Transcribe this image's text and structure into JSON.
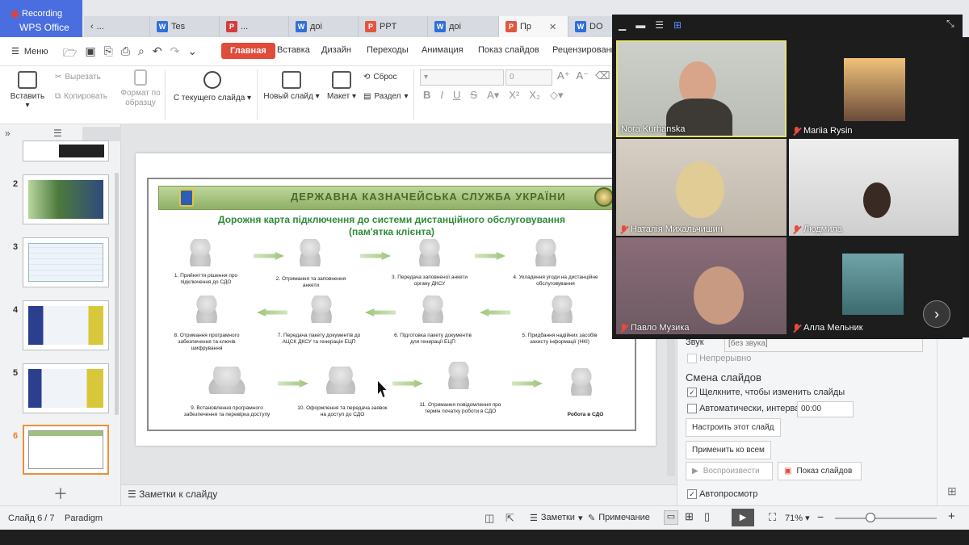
{
  "app": {
    "recording_label": "Recording",
    "home_label": "WPS Office"
  },
  "tabs": [
    {
      "label": "...",
      "icon": "back-arrow"
    },
    {
      "label": "Tes",
      "type": "writer"
    },
    {
      "label": "...",
      "type": "pdf"
    },
    {
      "label": "доі",
      "type": "writer"
    },
    {
      "label": "PPT",
      "type": "presentation"
    },
    {
      "label": "доі",
      "type": "writer"
    },
    {
      "label": "Пр",
      "type": "presentation",
      "active": true
    },
    {
      "label": "DO",
      "type": "writer"
    }
  ],
  "menu": {
    "menu_label": "Меню",
    "tabs": [
      "Главная",
      "Вставка",
      "Дизайн",
      "Переходы",
      "Анимация",
      "Показ слайдов",
      "Рецензирование"
    ]
  },
  "ribbon": {
    "paste": "Вставить",
    "cut": "Вырезать",
    "copy": "Копировать",
    "format_painter": "Формат по образцу",
    "from_current": "С текущего слайда",
    "new_slide": "Новый слайд",
    "layout": "Макет",
    "reset": "Сброс",
    "section": "Раздел",
    "font_size": "0"
  },
  "slides": {
    "numbers": [
      "2",
      "3",
      "4",
      "5",
      "6"
    ],
    "selected": "6"
  },
  "slide_content": {
    "banner": "ДЕРЖАВНА КАЗНАЧЕЙСЬКА СЛУЖБА УКРАЇНИ",
    "title_line1": "Дорожня карта підключення до системи дистанційного обслуговування",
    "title_line2": "(пам'ятка клієнта)",
    "steps": [
      "1. Прийняття рішення про підключення до СДО",
      "2. Отримання та заповнення анкети",
      "3. Передача заповненої анкети органу ДКСУ",
      "4. Укладення угоди на дистанційне обслуговування",
      "5. Придбання надійних засобів захисту інформації (НКІ)",
      "6. Підготовка пакету документів для генерації ЕЦП",
      "7. Передача пакету документів до АЦСК ДКСУ та генерація ЕЦП",
      "8. Отримання програмного забезпечення та ключів шифрування",
      "9. Встановлення програмного забезпечення та перевірка доступу",
      "10. Оформлення та передача заявок на доступ до СДО",
      "11. Отримання повідомлення про термін початку роботи в СДО",
      "Робота в СДО"
    ]
  },
  "notes_label": "Заметки к слайду",
  "right_panel": {
    "sound_label": "Звук",
    "sound_value": "[без звука]",
    "continuous": "Непрерывно",
    "heading": "Смена слайдов",
    "on_click": "Щелкните, чтобы изменить слайды",
    "auto_label": "Автоматически, интервал:",
    "auto_value": "00:00",
    "configure": "Настроить этот слайд",
    "apply_all": "Применить ко всем",
    "play": "Воспроизвести",
    "slideshow": "Показ слайдов",
    "autopreview": "Автопросмотр"
  },
  "status": {
    "slide_pos": "Слайд 6 / 7",
    "theme": "Paradigm",
    "notes": "Заметки",
    "comment": "Примечание",
    "zoom": "71%"
  },
  "participants": [
    {
      "name": "Nora  Kurhanska",
      "muted": false
    },
    {
      "name": "Mariia Rysin",
      "muted": true
    },
    {
      "name": "Наталія Михальчишин",
      "muted": true
    },
    {
      "name": "Людмила",
      "muted": true
    },
    {
      "name": "Павло Музика",
      "muted": true
    },
    {
      "name": "Алла Мельник",
      "muted": true
    }
  ],
  "colors": {
    "accent_red": "#e04b3a",
    "wps_blue": "#4a6ee0",
    "active_speaker": "#e8e27a",
    "mute_red": "#e64b3c"
  }
}
